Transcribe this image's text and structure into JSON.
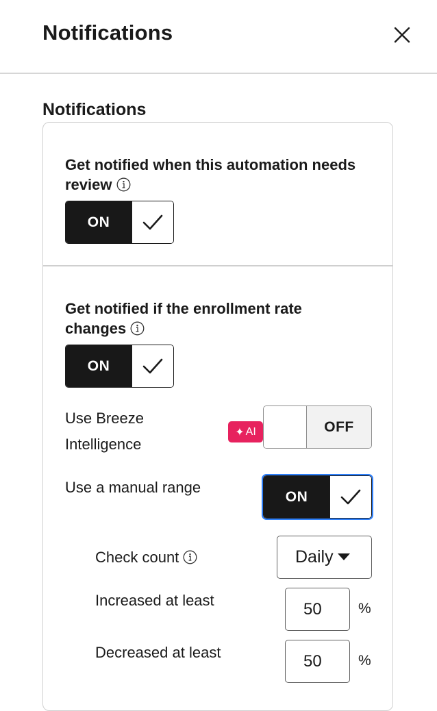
{
  "header": {
    "title": "Notifications"
  },
  "section": {
    "title": "Notifications"
  },
  "review": {
    "label": "Get notified when this automation needs review",
    "toggle": "ON"
  },
  "enrollment": {
    "label": "Get notified if the enrollment rate changes",
    "toggle": "ON",
    "breeze": {
      "label_line1": "Use Breeze",
      "label_line2": "Intelligence",
      "badge": "AI",
      "toggle": "OFF"
    },
    "manual_range": {
      "label": "Use a manual range",
      "toggle": "ON"
    },
    "check_count": {
      "label": "Check count",
      "value": "Daily"
    },
    "increased": {
      "label": "Increased at least",
      "value": "50",
      "unit": "%"
    },
    "decreased": {
      "label": "Decreased at least",
      "value": "50",
      "unit": "%"
    }
  },
  "colors": {
    "toggle_on": "#181818",
    "ai_badge": "#e7225e",
    "focus": "#2d7ff9"
  }
}
